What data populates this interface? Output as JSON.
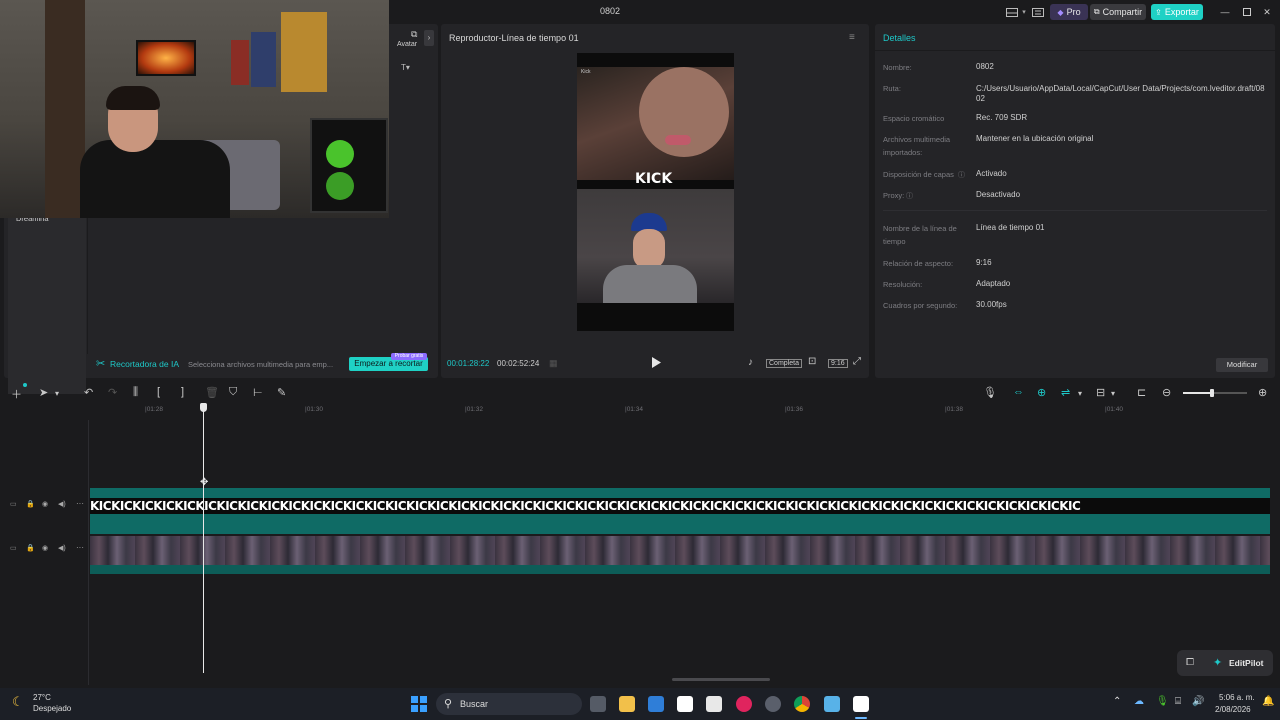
{
  "window": {
    "title": "0802"
  },
  "header": {
    "pro_label": "Pro",
    "share_label": "Compartir",
    "export_label": "Exportar"
  },
  "media": {
    "avatar_tab": "Avatar",
    "sidebar_partial": "Dreamina"
  },
  "ai_cutter": {
    "label": "Recortadora de IA",
    "hint": "Selecciona archivos multimedia para emp...",
    "button": "Empezar a recortar",
    "badge": "Probar gratis"
  },
  "player": {
    "title": "Reproductor-Línea de tiempo 01",
    "current_time": "00:01:28:22",
    "total_time": "00:02:52:24",
    "full_label": "Completa",
    "ratio_label": "9:16",
    "overlay_text": "KICK",
    "small_caption": "Kick"
  },
  "details": {
    "title": "Detalles",
    "fields": [
      {
        "label": "Nombre:",
        "value": "0802"
      },
      {
        "label": "Ruta:",
        "value": "C:/Users/Usuario/AppData/Local/CapCut/User Data/Projects/com.lveditor.draft/0802"
      },
      {
        "label": "Espacio cromático",
        "value": "Rec. 709 SDR"
      },
      {
        "label": "Archivos multimedia importados:",
        "value": "Mantener en la ubicación original"
      },
      {
        "label": "Disposición de capas",
        "value": "Activado"
      },
      {
        "label": "Proxy:",
        "value": "Desactivado"
      },
      {
        "label": "Nombre de la línea de tiempo",
        "value": "Línea de tiempo 01"
      },
      {
        "label": "Relación de aspecto:",
        "value": "9:16"
      },
      {
        "label": "Resolución:",
        "value": "Adaptado"
      },
      {
        "label": "Cuadros por segundo:",
        "value": "30.00fps"
      }
    ],
    "modify_button": "Modificar"
  },
  "timeline": {
    "ticks": [
      "|01:28",
      "|01:30",
      "|01:32",
      "|01:34",
      "|01:36",
      "|01:38",
      "|01:40"
    ],
    "text_track_content": "KICKICKICKICKICKICKICKICKICKICKICKICKICKICKICKICKICKICKICKICKICKICKICKICKICKICKICKICKICKICKICKICKICKICKICKICKICKICKICKICKICKICKICKICKICKICKIC",
    "editpilot": "EditPilot"
  },
  "taskbar": {
    "temperature": "27°C",
    "weather": "Despejado",
    "search_placeholder": "Buscar",
    "time": "5:06 a. m.",
    "date": "2/08/2026"
  },
  "colors": {
    "accent": "#1ec8c8",
    "export": "#1fd1c5",
    "panel": "#242427",
    "background": "#1b1b1d"
  }
}
